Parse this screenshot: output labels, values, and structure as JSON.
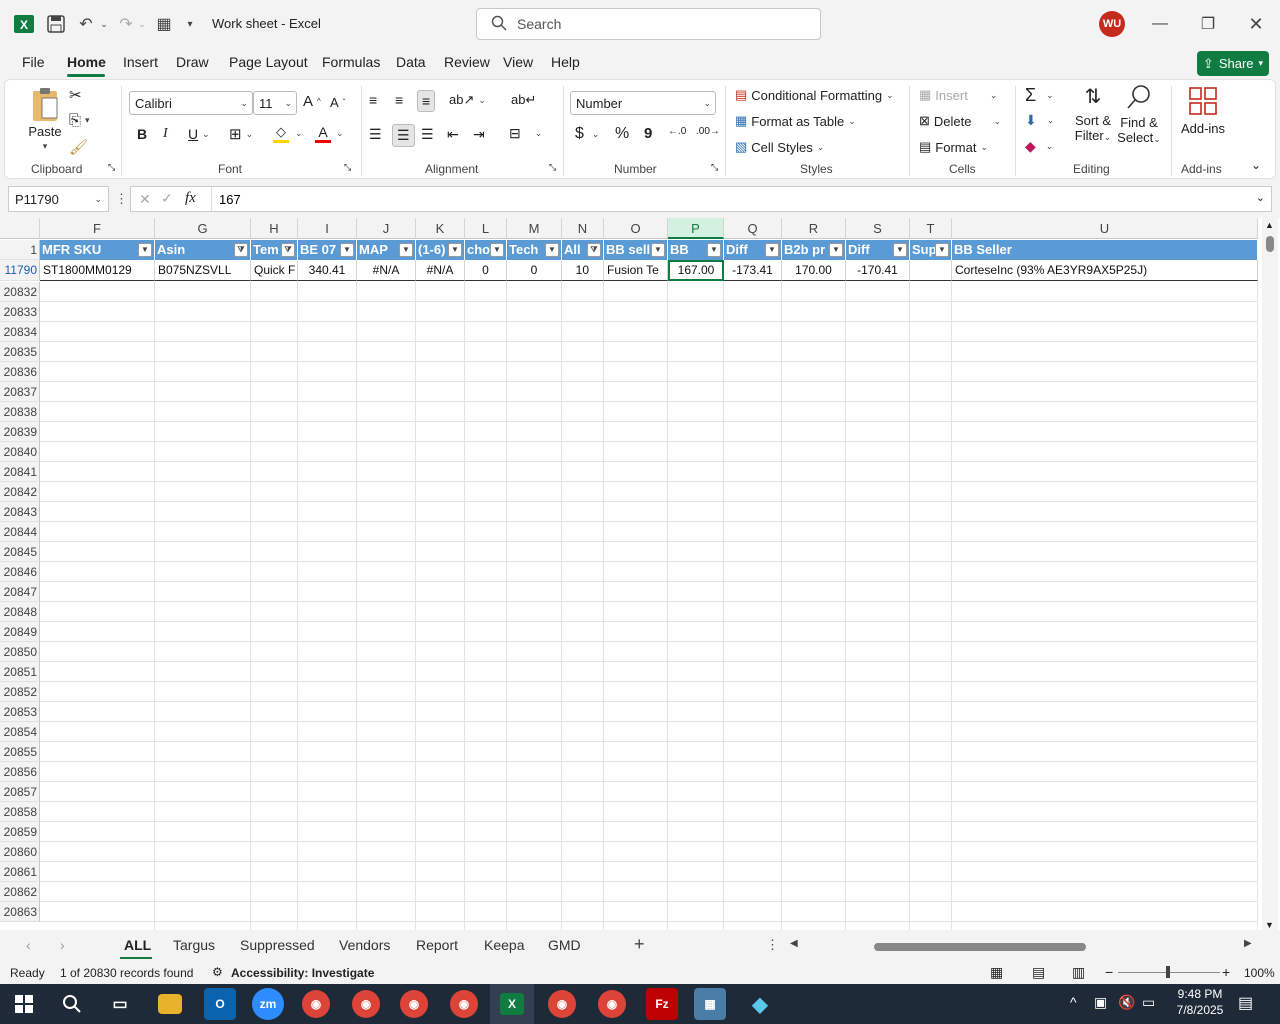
{
  "window": {
    "title": "Work sheet  -  Excel",
    "search_placeholder": "Search",
    "user_initials": "WU"
  },
  "menu": {
    "tabs": [
      "File",
      "Home",
      "Insert",
      "Draw",
      "Page Layout",
      "Formulas",
      "Data",
      "Review",
      "View",
      "Help"
    ],
    "active": "Home",
    "share_label": "Share"
  },
  "ribbon": {
    "clipboard": {
      "paste": "Paste",
      "label": "Clipboard"
    },
    "font": {
      "name": "Calibri",
      "size": "11",
      "label": "Font",
      "bold": "B",
      "italic": "I",
      "underline": "U"
    },
    "alignment": {
      "label": "Alignment"
    },
    "number": {
      "format": "Number",
      "label": "Number",
      "currency": "$",
      "percent": "%",
      "comma": "9"
    },
    "styles": {
      "conditional": "Conditional Formatting",
      "format_table": "Format as Table",
      "cell_styles": "Cell Styles",
      "label": "Styles"
    },
    "cells": {
      "insert": "Insert",
      "delete": "Delete",
      "format": "Format",
      "label": "Cells"
    },
    "editing": {
      "sort": "Sort &",
      "filter": "Filter",
      "find": "Find &",
      "select": "Select",
      "label": "Editing"
    },
    "addins": {
      "button": "Add-ins",
      "label": "Add-ins"
    }
  },
  "formula_bar": {
    "name_box": "P11790",
    "formula": "167",
    "fx": "fx"
  },
  "columns": [
    "F",
    "G",
    "H",
    "I",
    "J",
    "K",
    "L",
    "M",
    "N",
    "O",
    "P",
    "Q",
    "R",
    "S",
    "T",
    "U"
  ],
  "selected_column": "P",
  "header_row_number": "1",
  "headers": [
    "MFR SKU",
    "Asin",
    "Tem",
    "BE 07",
    "MAP",
    "(1-6)",
    "cho",
    "Tech",
    "All",
    "BB sell",
    "BB",
    "Diff",
    "B2b pr",
    "Diff",
    "Sup",
    "BB Seller"
  ],
  "data_row": {
    "row_number": "11790",
    "cells": [
      "ST1800MM0129",
      "B075NZSVLL",
      "Quick F",
      "340.41",
      "#N/A",
      "#N/A",
      "0",
      "0",
      "10",
      "Fusion Te",
      "167.00",
      "-173.41",
      "170.00",
      "-170.41",
      "",
      "CorteseInc (93% AE3YR9AX5P25J)"
    ]
  },
  "row_numbers": [
    "20832",
    "20833",
    "20834",
    "20835",
    "20836",
    "20837",
    "20838",
    "20839",
    "20840",
    "20841",
    "20842",
    "20843",
    "20844",
    "20845",
    "20846",
    "20847",
    "20848",
    "20849",
    "20850",
    "20851",
    "20852",
    "20853",
    "20854",
    "20855",
    "20856",
    "20857",
    "20858",
    "20859",
    "20860",
    "20861",
    "20862",
    "20863"
  ],
  "sheets": [
    "ALL",
    "Targus",
    "Suppressed",
    "Vendors",
    "Report",
    "Keepa",
    "GMD"
  ],
  "active_sheet": "ALL",
  "status": {
    "ready": "Ready",
    "records": "1 of 20830 records found",
    "accessibility": "Accessibility: Investigate",
    "zoom": "100%"
  },
  "taskbar": {
    "time": "9:48 PM",
    "date": "7/8/2025"
  },
  "colors": {
    "excel_green": "#107c41",
    "table_header": "#5b9bd5",
    "taskbar": "#1f2a38"
  }
}
